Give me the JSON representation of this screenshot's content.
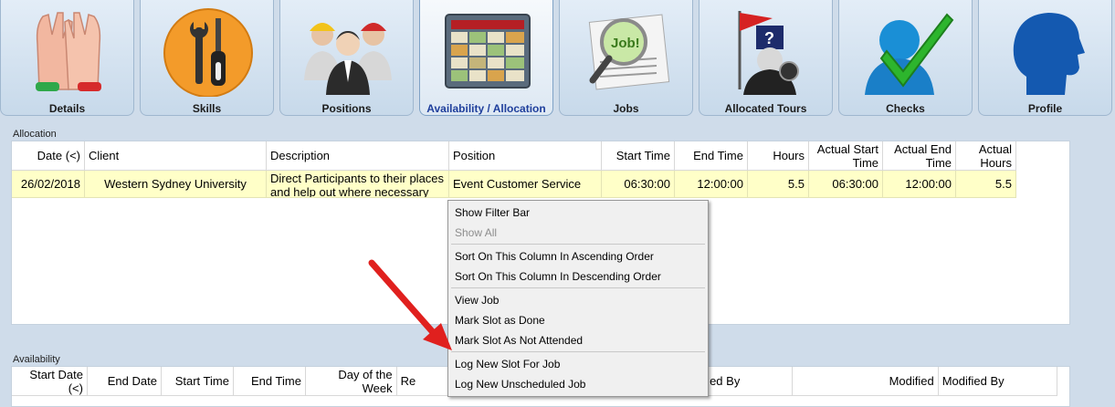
{
  "tabs": [
    {
      "label": "Details",
      "icon": "clapping-hands-icon"
    },
    {
      "label": "Skills",
      "icon": "wrench-screwdriver-icon"
    },
    {
      "label": "Positions",
      "icon": "workers-group-icon"
    },
    {
      "label": "Availability / Allocation",
      "icon": "calendar-icon"
    },
    {
      "label": "Jobs",
      "icon": "newspaper-magnifier-icon"
    },
    {
      "label": "Allocated Tours",
      "icon": "flag-tourist-icon"
    },
    {
      "label": "Checks",
      "icon": "person-checkmark-icon"
    },
    {
      "label": "Profile",
      "icon": "head-profile-icon"
    }
  ],
  "allocation": {
    "label": "Allocation",
    "headers": {
      "date": "Date (<)",
      "client": "Client",
      "description": "Description",
      "position": "Position",
      "start_time": "Start Time",
      "end_time": "End Time",
      "hours": "Hours",
      "actual_start": "Actual Start Time",
      "actual_end": "Actual End Time",
      "actual_hours": "Actual Hours"
    },
    "rows": [
      {
        "date": "26/02/2018",
        "client": "Western Sydney University",
        "description": "Direct Participants to their places and help out where necessary",
        "position": "Event Customer Service",
        "start_time": "06:30:00",
        "end_time": "12:00:00",
        "hours": "5.5",
        "actual_start": "06:30:00",
        "actual_end": "12:00:00",
        "actual_hours": "5.5"
      }
    ]
  },
  "availability": {
    "label": "Availability",
    "headers": {
      "start_date": "Start Date (<)",
      "end_date": "End Date",
      "start_time": "Start Time",
      "end_time": "End Time",
      "day_of_week": "Day of the Week",
      "re": "Re",
      "created_by": "ed By",
      "modified": "Modified",
      "modified_by": "Modified By"
    }
  },
  "context_menu": {
    "groups": [
      [
        {
          "label": "Show Filter Bar",
          "enabled": true
        },
        {
          "label": "Show All",
          "enabled": false
        }
      ],
      [
        {
          "label": "Sort On This Column In Ascending Order",
          "enabled": true
        },
        {
          "label": "Sort On This Column In Descending Order",
          "enabled": true
        }
      ],
      [
        {
          "label": "View Job",
          "enabled": true
        },
        {
          "label": "Mark Slot as Done",
          "enabled": true
        },
        {
          "label": "Mark Slot As Not Attended",
          "enabled": true
        }
      ],
      [
        {
          "label": "Log New Slot For Job",
          "enabled": true
        },
        {
          "label": "Log New Unscheduled Job",
          "enabled": true
        }
      ]
    ]
  },
  "colors": {
    "selected_row": "#ffffc8",
    "annotation_arrow": "#e0201e",
    "active_tab_label": "#1f3f9c"
  }
}
